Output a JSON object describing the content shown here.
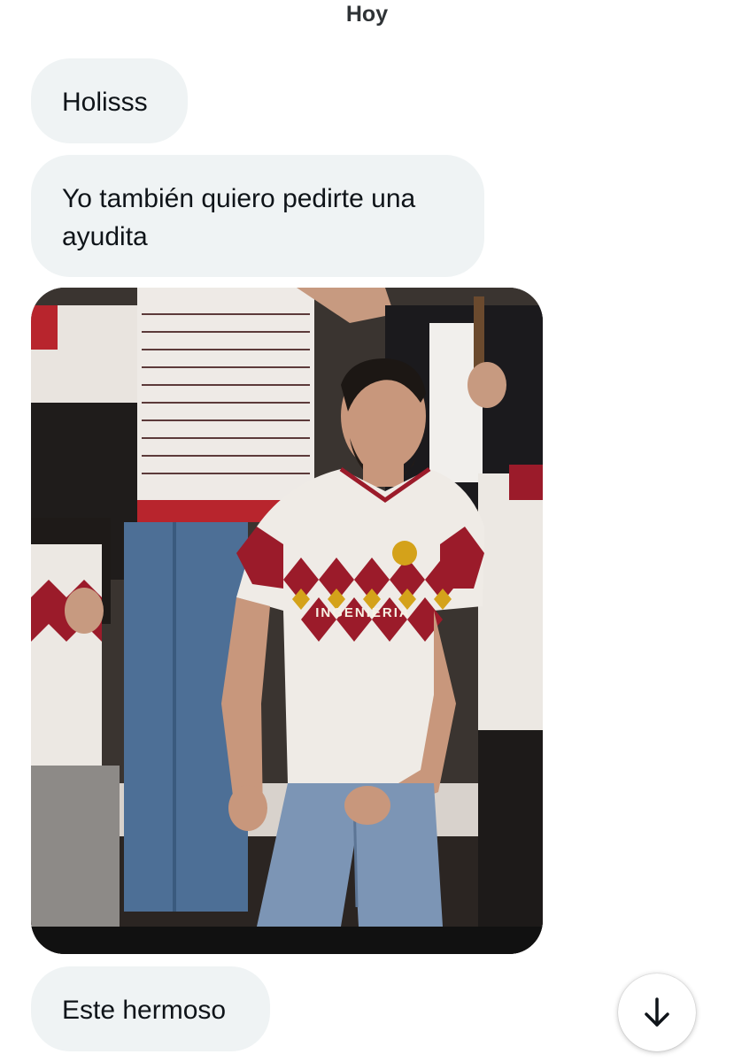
{
  "conversation": {
    "date_label": "Hoy",
    "messages": [
      {
        "type": "text",
        "text": "Holisss"
      },
      {
        "type": "text",
        "text": "Yo también quiero pedirte una ayudita"
      },
      {
        "type": "image",
        "jersey_text": "INGENIERIA"
      },
      {
        "type": "text",
        "text": "Este hermoso"
      }
    ]
  },
  "controls": {
    "scroll_down_icon": "arrow-down-icon"
  },
  "colors": {
    "bubble_bg": "#eff3f4",
    "text": "#0f1419",
    "jersey_red": "#9b1b2a",
    "jersey_gold": "#d4a21a"
  }
}
